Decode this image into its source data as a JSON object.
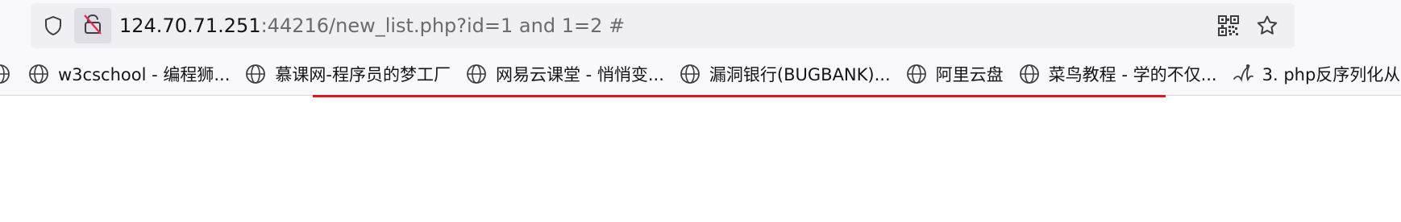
{
  "urlbar": {
    "host": "124.70.71.251",
    "rest": ":44216/new_list.php?id=1 and 1=2 #"
  },
  "icons": {
    "tracking": "shield-icon",
    "lock": "insecure-lock-icon",
    "qr": "qr-code-icon",
    "bookmark": "star-icon",
    "globe": "globe-icon"
  },
  "bookmarks": [
    {
      "label": "w3cschool - 编程狮...",
      "icon": "globe-icon"
    },
    {
      "label": "慕课网-程序员的梦工厂",
      "icon": "globe-icon"
    },
    {
      "label": "网易云课堂 - 悄悄变...",
      "icon": "globe-icon"
    },
    {
      "label": "漏洞银行(BUGBANK)...",
      "icon": "globe-icon"
    },
    {
      "label": "阿里云盘",
      "icon": "globe-icon"
    },
    {
      "label": "菜鸟教程 - 学的不仅...",
      "icon": "globe-icon"
    },
    {
      "label": "3. php反序列化从",
      "icon": "custom-favicon-icon"
    }
  ],
  "colors": {
    "rule": "#e8141b",
    "toolbar_bg": "#f9f9fb",
    "urlbar_bg": "#f0f0f4"
  }
}
